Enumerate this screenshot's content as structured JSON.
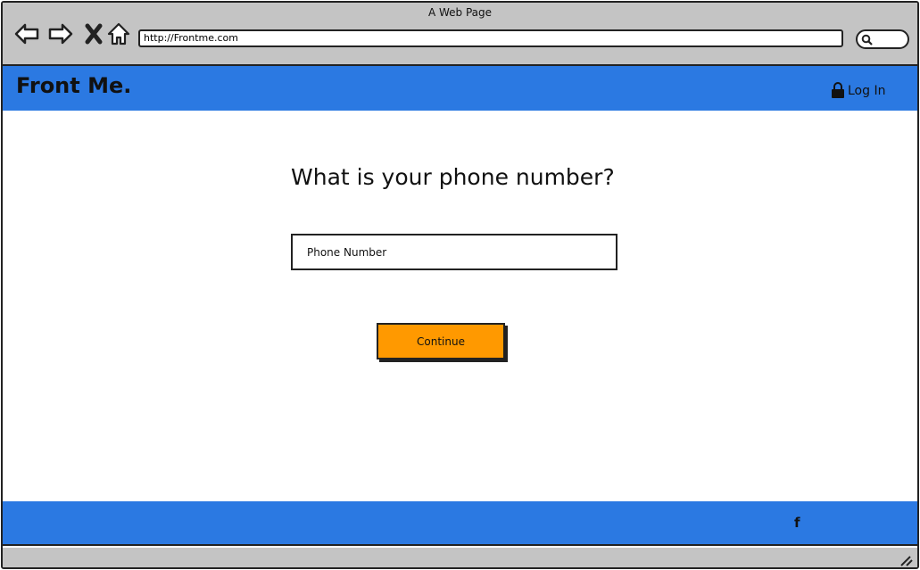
{
  "window": {
    "title": "A Web Page"
  },
  "browser": {
    "url": "http://Frontme.com",
    "icons": [
      "back-arrow-icon",
      "forward-arrow-icon",
      "close-x-icon",
      "home-icon",
      "search-icon"
    ]
  },
  "header": {
    "brand": "Front Me.",
    "login_label": "Log In",
    "login_icon": "lock-icon",
    "color": "#2b79e2"
  },
  "form": {
    "question": "What is your phone number?",
    "phone_placeholder": "Phone Number",
    "continue_label": "Continue",
    "button_color": "#ff9900"
  },
  "footer": {
    "facebook_label": "f",
    "color": "#2b79e2"
  }
}
